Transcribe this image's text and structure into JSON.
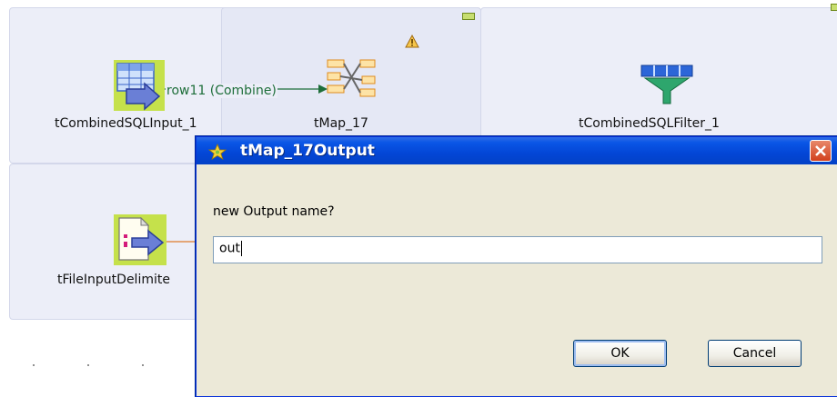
{
  "canvas": {
    "components": [
      {
        "label": "tCombinedSQLInput_1",
        "icon": "table-input-icon"
      },
      {
        "label": "tMap_17",
        "icon": "tmap-icon"
      },
      {
        "label": "tCombinedSQLFilter_1",
        "icon": "funnel-filter-icon"
      },
      {
        "label": "tFileInputDelimite",
        "icon": "file-input-icon"
      }
    ],
    "link_label": "row11 (Combine)",
    "warning_icon": "warning-icon"
  },
  "dialog": {
    "title": "tMap_17Output",
    "prompt": "new Output name?",
    "input_value": "out",
    "ok_label": "OK",
    "cancel_label": "Cancel"
  },
  "colors": {
    "titlebar": "#0346d6",
    "dialog_bg": "#ece9d8",
    "subjob_bg": "#eceef8",
    "link": "#1e6e3a"
  }
}
